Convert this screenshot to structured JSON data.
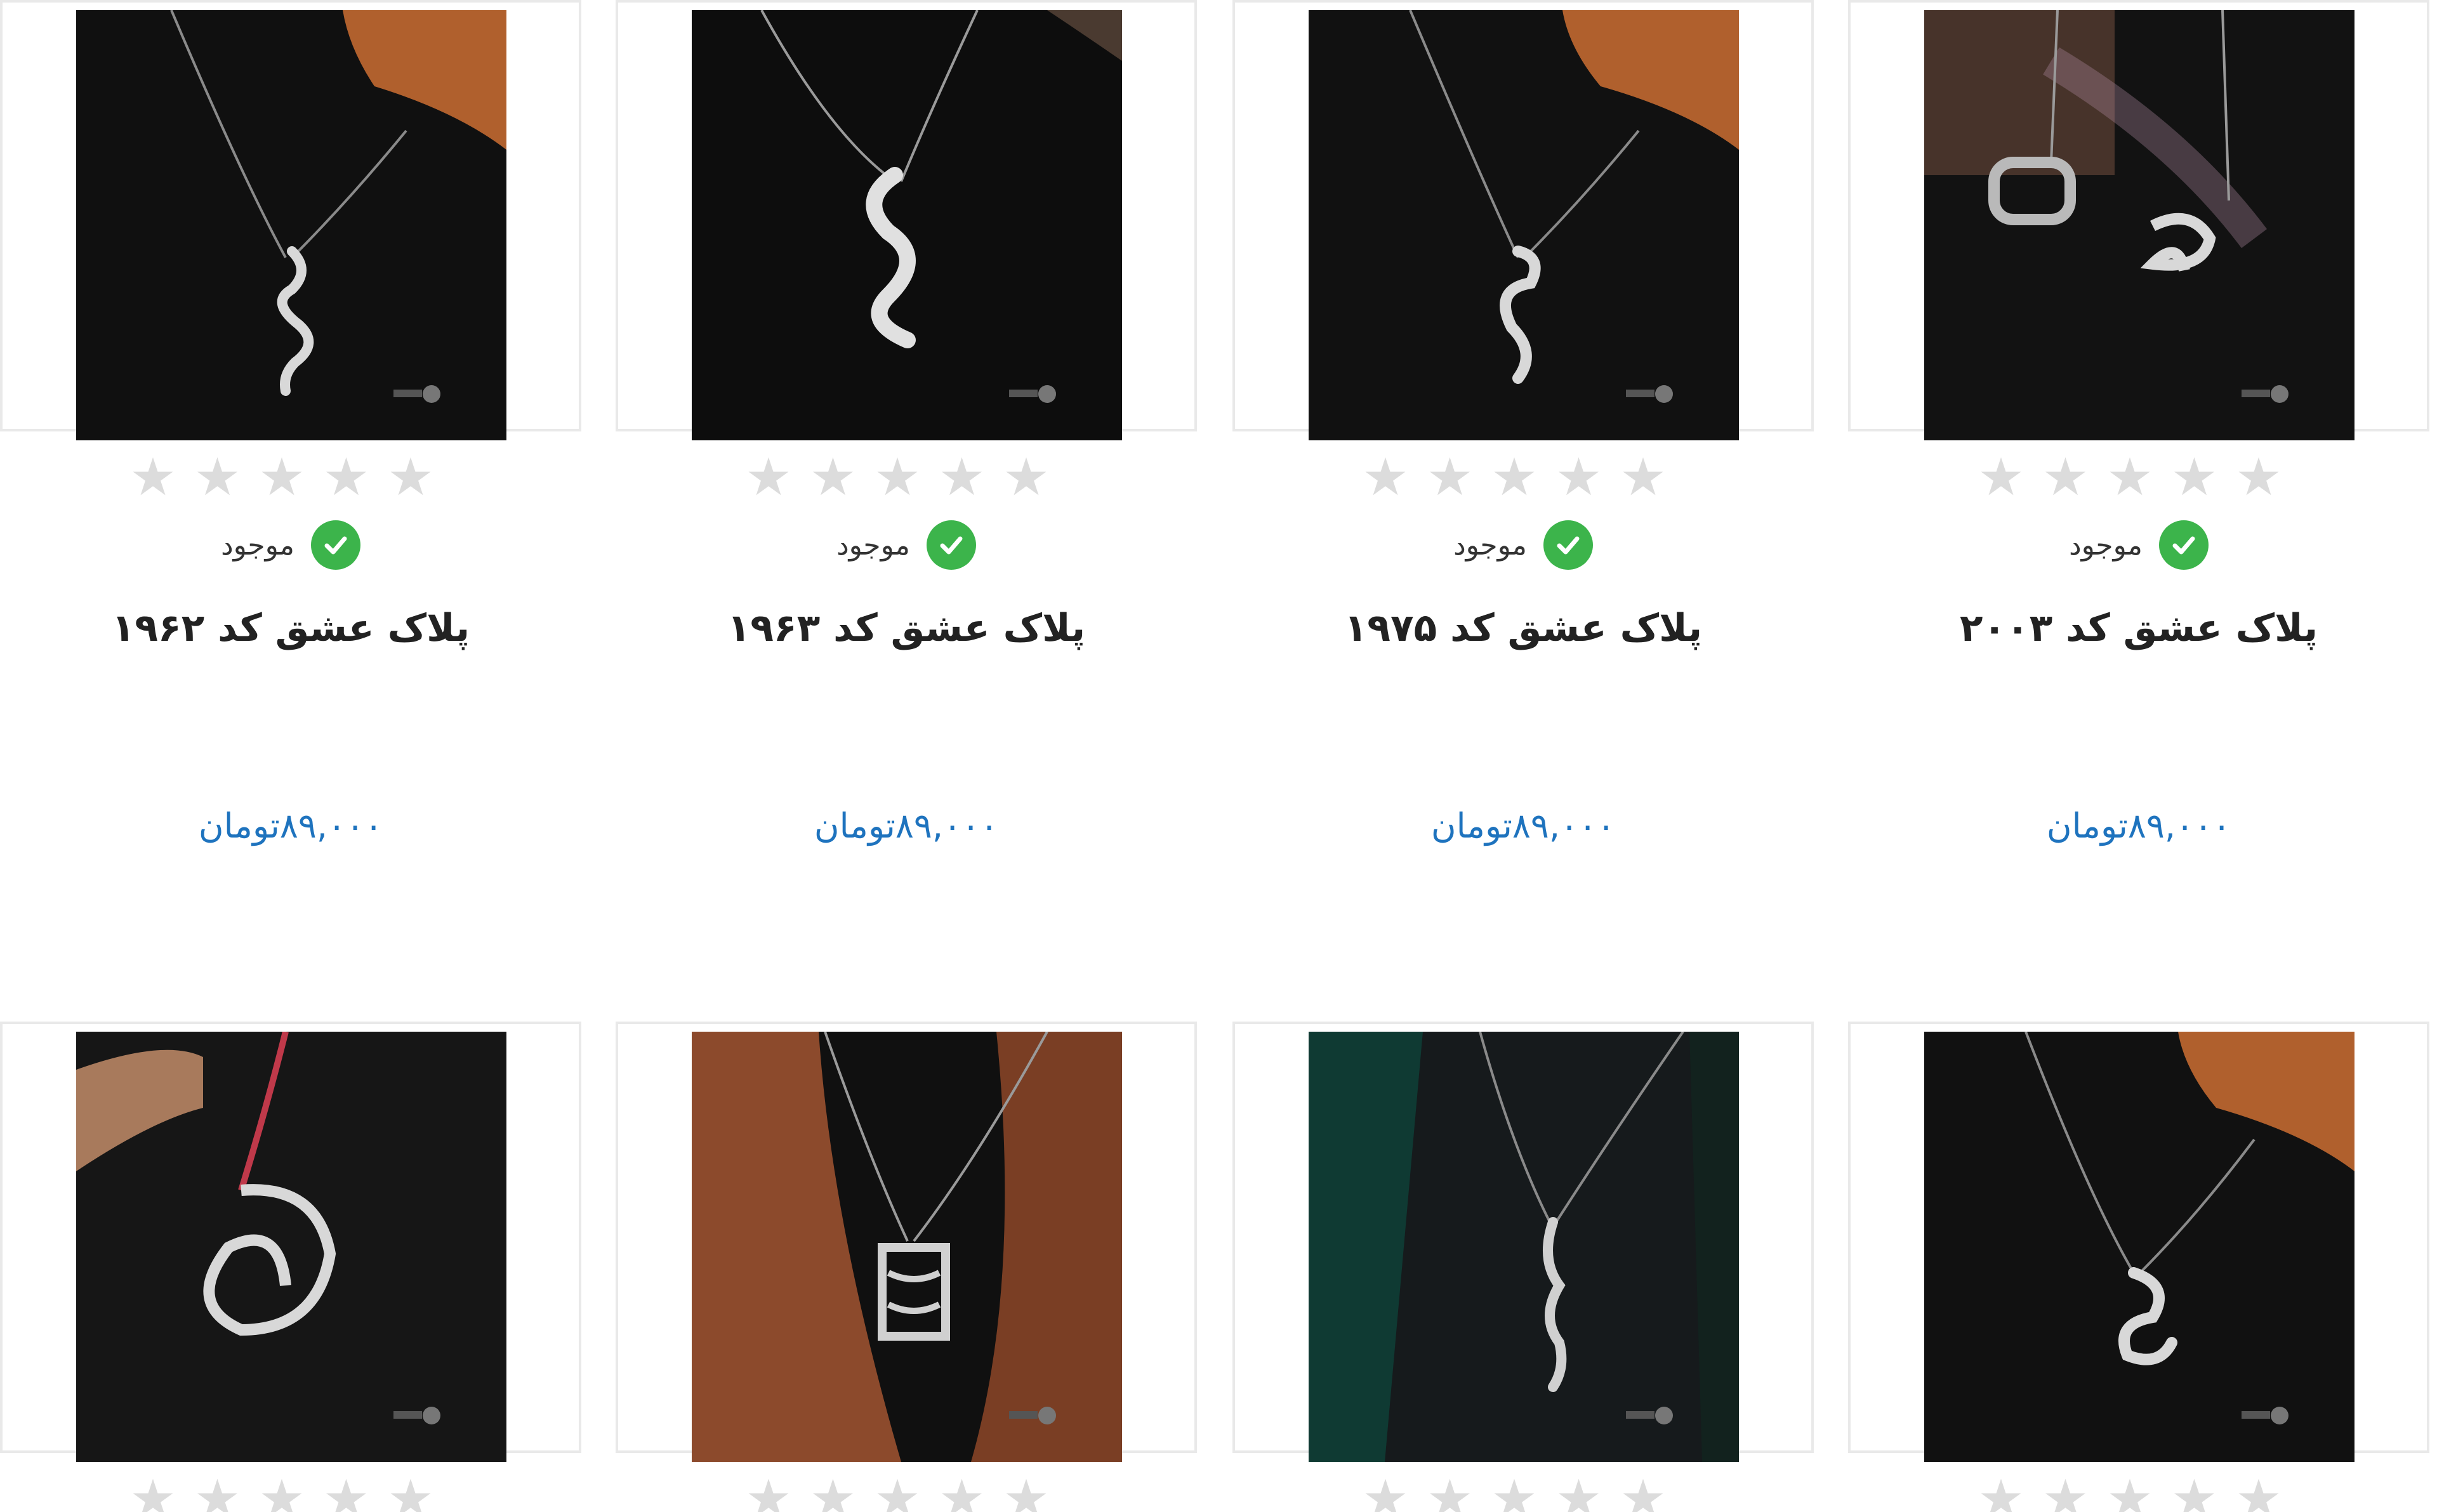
{
  "products": [
    {
      "title": "پلاک عشق کد ۱۹۶۲",
      "stock": "موجود",
      "price": "۸۹,۰۰۰تومان",
      "stars": "★★★★★"
    },
    {
      "title": "پلاک عشق کد ۱۹۶۳",
      "stock": "موجود",
      "price": "۸۹,۰۰۰تومان",
      "stars": "★★★★★"
    },
    {
      "title": "پلاک عشق کد ۱۹۷۵",
      "stock": "موجود",
      "price": "۸۹,۰۰۰تومان",
      "stars": "★★★★★"
    },
    {
      "title": "پلاک عشق کد ۲۰۰۳",
      "stock": "موجود",
      "price": "۸۹,۰۰۰تومان",
      "stars": "★★★★★"
    }
  ],
  "second_row": [
    {
      "stars": "★★★★★"
    },
    {
      "stars": "★★★★★"
    },
    {
      "stars": "★★★★★"
    },
    {
      "stars": "★★★★★"
    }
  ],
  "colors": {
    "price": "#1e73be",
    "in_stock": "#3cb44b",
    "star_empty": "#dcdcdc"
  }
}
